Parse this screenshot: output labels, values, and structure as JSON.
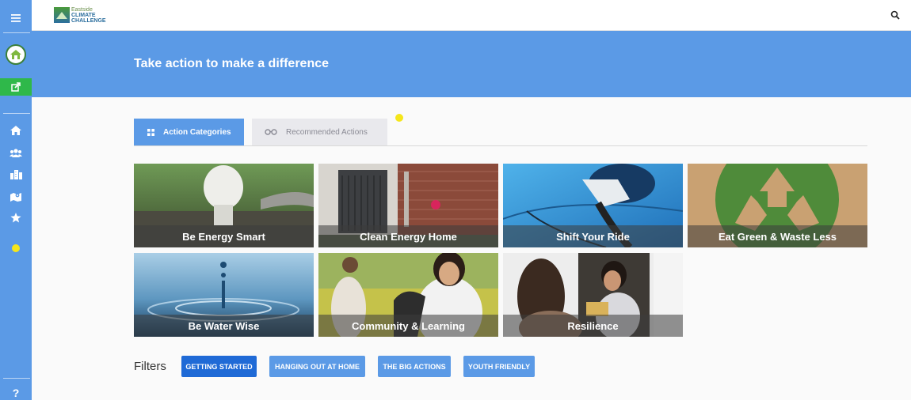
{
  "app": {
    "logo": {
      "line1": "Eastside",
      "line2": "CLIMATE",
      "line3": "CHALLENGE"
    }
  },
  "sidebar": {
    "items": [
      {
        "icon": "hamburger-menu-icon"
      },
      {
        "icon": "home-avatar-icon"
      },
      {
        "icon": "share-icon"
      },
      {
        "icon": "home-icon"
      },
      {
        "icon": "users-icon"
      },
      {
        "icon": "city-icon"
      },
      {
        "icon": "map-icon"
      },
      {
        "icon": "star-icon"
      },
      {
        "icon": "yellow-dot-icon"
      },
      {
        "icon": "help-icon",
        "label": "?"
      }
    ]
  },
  "banner": {
    "title": "Take action to make a difference"
  },
  "tabs": [
    {
      "label": "Action Categories",
      "icon": "grid-icon",
      "active": true
    },
    {
      "label": "Recommended Actions",
      "icon": "glasses-icon",
      "active": false
    }
  ],
  "categories": [
    {
      "label": "Be Energy Smart"
    },
    {
      "label": "Clean Energy Home"
    },
    {
      "label": "Shift Your Ride"
    },
    {
      "label": "Eat Green & Waste Less"
    },
    {
      "label": "Be Water Wise"
    },
    {
      "label": "Community & Learning"
    },
    {
      "label": "Resilience"
    }
  ],
  "filters": {
    "label": "Filters",
    "buttons": [
      {
        "label": "GETTING STARTED",
        "selected": true
      },
      {
        "label": "HANGING OUT AT HOME",
        "selected": false
      },
      {
        "label": "THE BIG ACTIONS",
        "selected": false
      },
      {
        "label": "YOUTH FRIENDLY",
        "selected": false
      }
    ]
  },
  "colors": {
    "primary": "#5b9ae6",
    "primary_dark": "#1f6ad6",
    "share_green": "#2fb84a",
    "accent_yellow": "#f5e61b"
  }
}
